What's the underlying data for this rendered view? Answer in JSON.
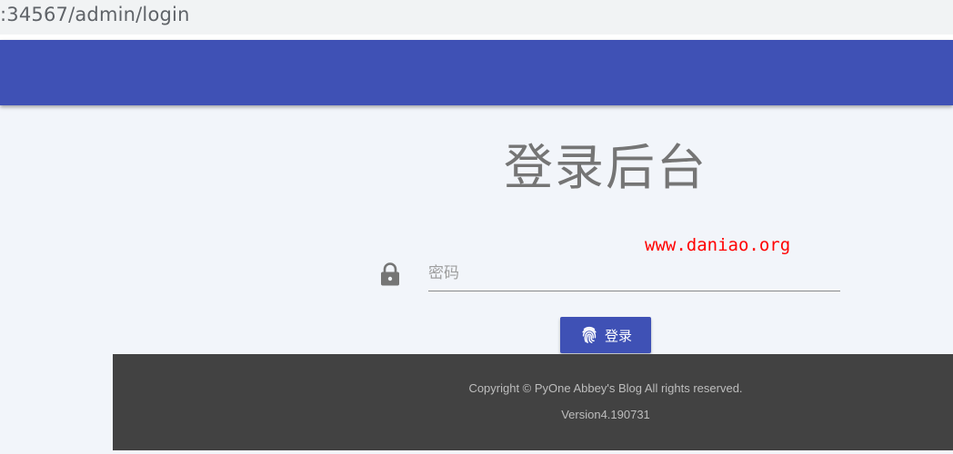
{
  "browser": {
    "url": ":34567/admin/login"
  },
  "main": {
    "title": "登录后台",
    "watermark": "www.daniao.org",
    "password_placeholder": "密码",
    "password_value": "",
    "login_button_label": "登录"
  },
  "footer": {
    "copyright": "Copyright © PyOne Abbey's Blog All rights reserved.",
    "version": "Version4.190731"
  },
  "icons": {
    "lock": "lock-icon",
    "fingerprint": "fingerprint-icon"
  },
  "colors": {
    "app_bar": "#3f51b5",
    "page_background": "#f2f5fa",
    "footer_background": "#424242",
    "button": "#3f51b5",
    "watermark": "#ff0000"
  }
}
